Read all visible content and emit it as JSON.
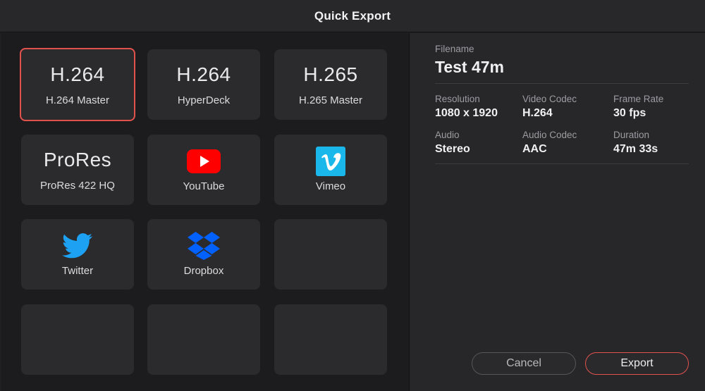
{
  "dialog": {
    "title": "Quick Export"
  },
  "presets": [
    {
      "big": "H.264",
      "label": "H.264 Master",
      "selected": true
    },
    {
      "big": "H.264",
      "label": "HyperDeck"
    },
    {
      "big": "H.265",
      "label": "H.265 Master"
    },
    {
      "big": "ProRes",
      "label": "ProRes 422 HQ"
    },
    {
      "icon": "youtube-icon",
      "label": "YouTube"
    },
    {
      "icon": "vimeo-icon",
      "label": "Vimeo"
    },
    {
      "icon": "twitter-icon",
      "label": "Twitter"
    },
    {
      "icon": "dropbox-icon",
      "label": "Dropbox"
    }
  ],
  "info": {
    "filename_label": "Filename",
    "filename": "Test 47m",
    "resolution_label": "Resolution",
    "resolution": "1080 x 1920",
    "video_codec_label": "Video Codec",
    "video_codec": "H.264",
    "frame_rate_label": "Frame Rate",
    "frame_rate": "30 fps",
    "audio_label": "Audio",
    "audio": "Stereo",
    "audio_codec_label": "Audio Codec",
    "audio_codec": "AAC",
    "duration_label": "Duration",
    "duration": "47m 33s"
  },
  "buttons": {
    "cancel": "Cancel",
    "export": "Export"
  },
  "colors": {
    "accent": "#e2524d",
    "youtube": "#ff0000",
    "vimeo": "#1ab7ea",
    "twitter": "#1da1f2",
    "dropbox": "#0061ff"
  }
}
